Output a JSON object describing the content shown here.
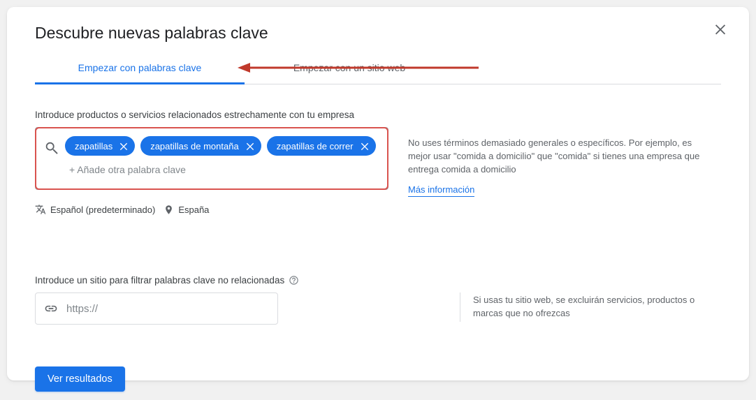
{
  "title": "Descubre nuevas palabras clave",
  "tabs": {
    "keywords": "Empezar con palabras clave",
    "website": "Empezar con un sitio web"
  },
  "keywords_section": {
    "label": "Introduce productos o servicios relacionados estrechamente con tu empresa",
    "chips": [
      "zapatillas",
      "zapatillas de montaña",
      "zapatillas de correr"
    ],
    "add_more": "+ Añade otra palabra clave",
    "hint": "No uses términos demasiado generales o específicos. Por ejemplo, es mejor usar \"comida a domicilio\" que \"comida\" si tienes una empresa que entrega comida a domicilio",
    "more_info": "Más información"
  },
  "lang_loc": {
    "language": "Español (predeterminado)",
    "location": "España"
  },
  "site_section": {
    "label": "Introduce un sitio para filtrar palabras clave no relacionadas",
    "placeholder": "https://",
    "hint": "Si usas tu sitio web, se excluirán servicios, productos o marcas que no ofrezcas"
  },
  "cta": "Ver resultados"
}
